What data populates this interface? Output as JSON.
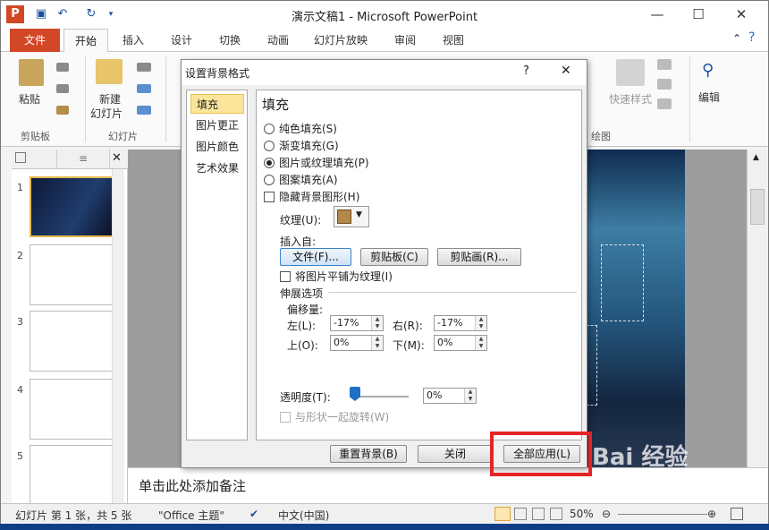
{
  "app": {
    "title": "演示文稿1 - Microsoft PowerPoint",
    "logo": "P"
  },
  "window_controls": {
    "minimize": "—",
    "maximize": "☐",
    "close": "✕"
  },
  "quick_access": [
    "save-icon",
    "undo-icon",
    "redo-icon",
    "customize-icon"
  ],
  "tabs": {
    "file": "文件",
    "items": [
      "开始",
      "插入",
      "设计",
      "切换",
      "动画",
      "幻灯片放映",
      "审阅",
      "视图"
    ]
  },
  "ribbon": {
    "paste": "粘贴",
    "clipboard_group": "剪贴板",
    "new_slide": "新建",
    "new_slide2": "幻灯片",
    "slides_group": "幻灯片",
    "quick_styles": "快速样式",
    "drawing_group": "绘图",
    "edit": "编辑"
  },
  "slides": {
    "numbers": [
      "1",
      "2",
      "3",
      "4",
      "5"
    ]
  },
  "dialog": {
    "title": "设置背景格式",
    "help": "?",
    "close": "✕",
    "nav": [
      "填充",
      "图片更正",
      "图片颜色",
      "艺术效果"
    ],
    "heading": "填充",
    "radios": [
      "纯色填充(S)",
      "渐变填充(G)",
      "图片或纹理填充(P)",
      "图案填充(A)"
    ],
    "hide_bg": "隐藏背景图形(H)",
    "texture_label": "纹理(U):",
    "insert_from": "插入自:",
    "btn_file": "文件(F)...",
    "btn_clipboard": "剪贴板(C)",
    "btn_clipart": "剪贴画(R)...",
    "tile": "将图片平铺为纹理(I)",
    "stretch": "伸展选项",
    "offset": "偏移量:",
    "left_label": "左(L):",
    "left_val": "-17%",
    "right_label": "右(R):",
    "right_val": "-17%",
    "top_label": "上(O):",
    "top_val": "0%",
    "bottom_label": "下(M):",
    "bottom_val": "0%",
    "transparency_label": "透明度(T):",
    "transparency_val": "0%",
    "rotate": "与形状一起旋转(W)",
    "reset": "重置背景(B)",
    "close_btn": "关闭",
    "apply_all": "全部应用(L)"
  },
  "notes": {
    "placeholder": "单击此处添加备注"
  },
  "status": {
    "slide": "幻灯片 第 1 张，共 5 张",
    "theme": "\"Office 主题\"",
    "lang": "中文(中国)",
    "zoom": "50%"
  },
  "watermark": "Bai 经验"
}
